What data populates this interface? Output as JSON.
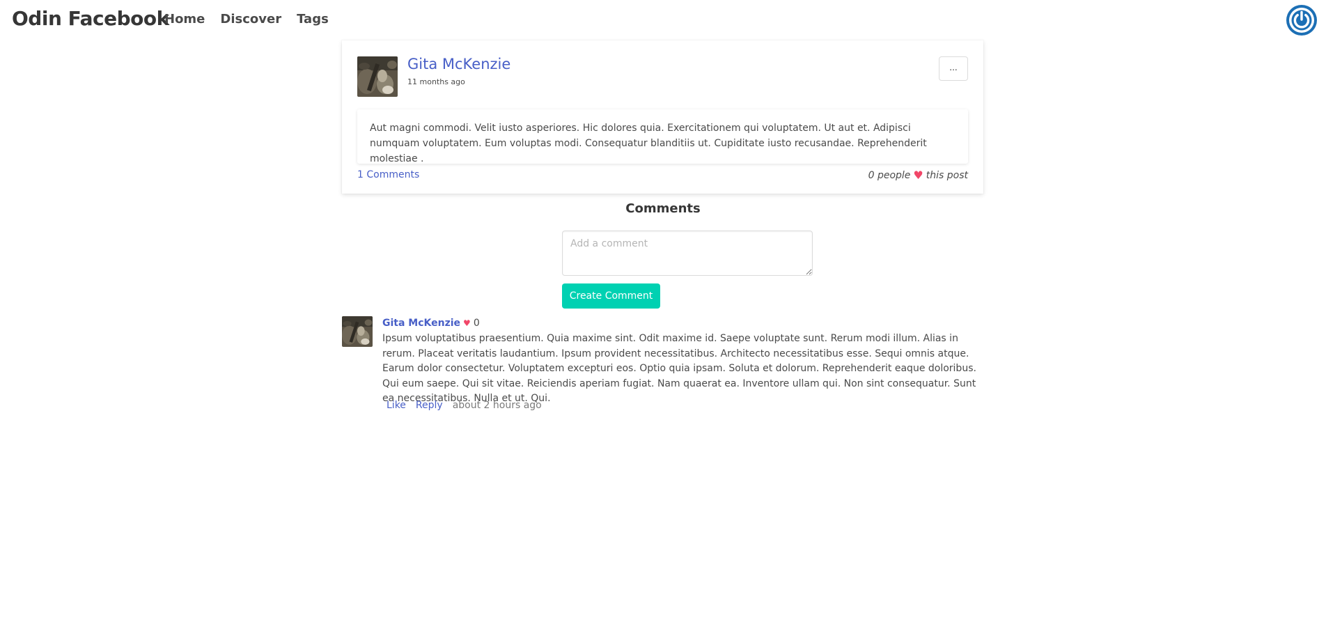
{
  "navbar": {
    "brand": "Odin Facebook",
    "links": [
      "Home",
      "Discover",
      "Tags"
    ],
    "power_icon": "power-icon"
  },
  "post": {
    "author": "Gita McKenzie",
    "time": "11 months ago",
    "more_label": "...",
    "body": "Aut magni commodi. Velit iusto asperiores. Hic dolores quia. Exercitationem qui voluptatem. Ut aut et. Adipisci numquam voluptatem. Eum voluptas modi. Consequatur blanditiis ut. Cupiditate iusto recusandae. Reprehenderit molestiae .",
    "comments_link": "1 Comments",
    "likes_prefix": "0 people",
    "likes_suffix": "this post"
  },
  "comments_section": {
    "title": "Comments",
    "input_placeholder": "Add a comment",
    "submit_label": "Create Comment"
  },
  "comments": [
    {
      "author": "Gita McKenzie",
      "likes": "0",
      "text": "Ipsum voluptatibus praesentium. Quia maxime sint. Odit maxime id. Saepe voluptate sunt. Rerum modi illum. Alias in rerum. Placeat veritatis laudantium. Ipsum provident necessitatibus. Architecto necessitatibus esse. Sequi omnis atque. Earum dolor consectetur. Voluptatem excepturi eos. Optio quia ipsam. Soluta et dolorum. Reprehenderit eaque doloribus. Qui eum saepe. Qui sit vitae. Reiciendis aperiam fugiat. Nam quaerat ea. Inventore ullam qui. Non sint consequatur. Sunt ea necessitatibus. Nulla et ut. Qui.",
      "like_label": "Like",
      "reply_label": "Reply",
      "time": "about 2 hours ago"
    }
  ],
  "colors": {
    "link": "#485fc7",
    "primary": "#00d1b2",
    "heart": "#f14668",
    "power": "#1c6fb5"
  }
}
